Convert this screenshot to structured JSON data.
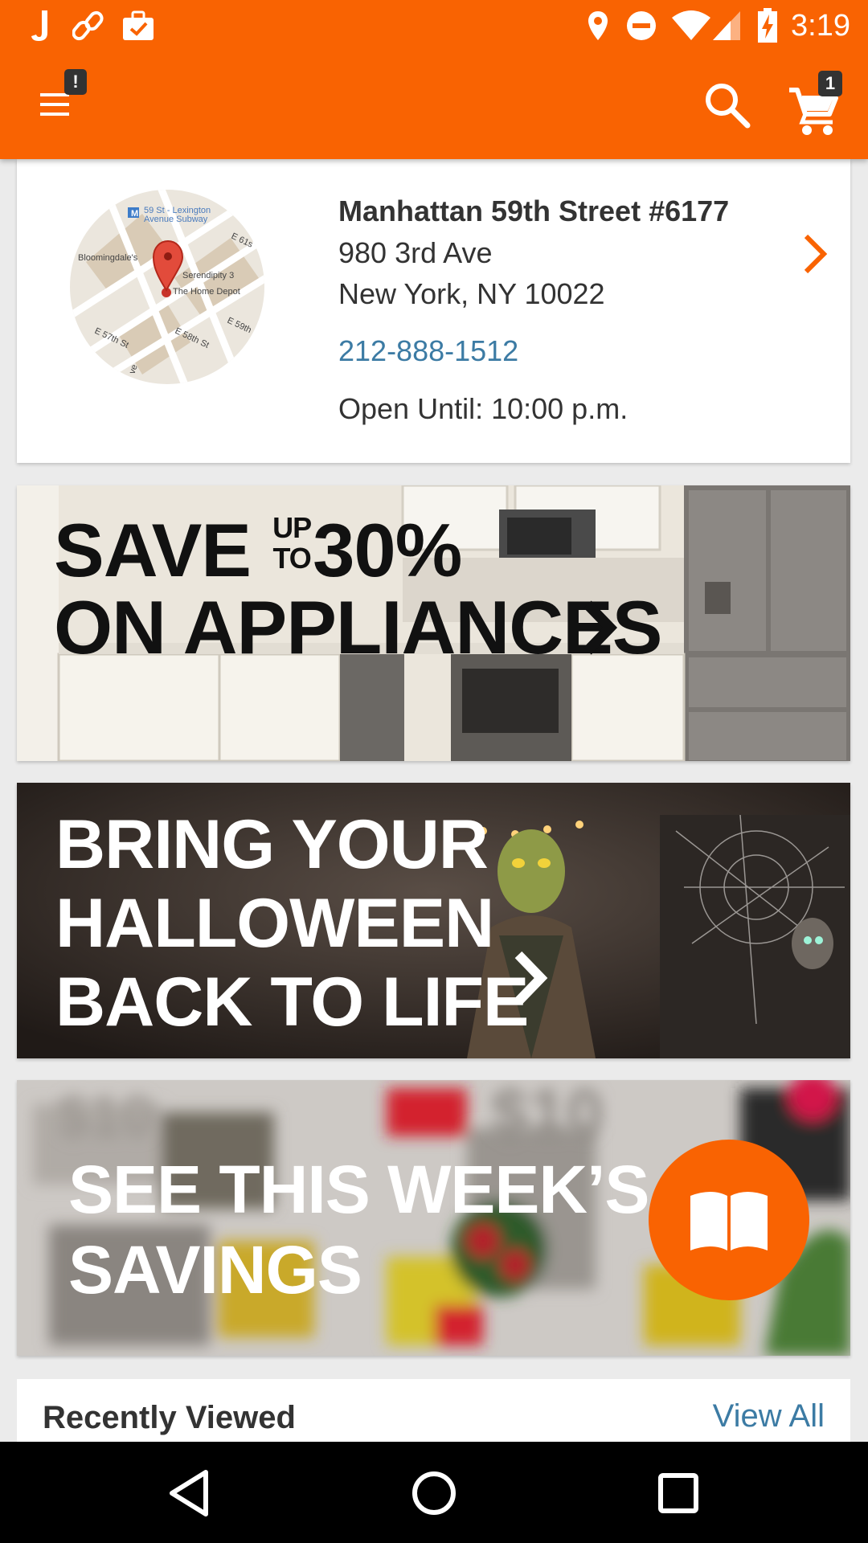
{
  "status_bar": {
    "time": "3:19",
    "left_icons": [
      "j-app-icon",
      "link-icon",
      "briefcase-check-icon"
    ],
    "right_icons": [
      "location-icon",
      "do-not-disturb-icon",
      "wifi-icon",
      "cell-signal-icon",
      "battery-charging-icon"
    ]
  },
  "app_bar": {
    "menu_badge": "!",
    "cart_count": "1"
  },
  "store": {
    "name": "Manhattan 59th Street #6177",
    "address_line1": "980 3rd Ave",
    "address_line2": "New York, NY 10022",
    "phone": "212-888-1512",
    "hours": "Open Until: 10:00 p.m.",
    "map": {
      "subway": "59 St - Lexington",
      "subway2": "Avenue Subway",
      "place1": "Bloomingdale's",
      "place2": "Serendipity 3",
      "place3": "The Home Depot",
      "street1": "E 61s",
      "street2": "E 59th",
      "street3": "E 58th St",
      "street4": "E 57th St",
      "street5": "ve"
    }
  },
  "banners": {
    "appliances": {
      "line1_a": "SAVE",
      "line1_up": "UP",
      "line1_to": "TO",
      "line1_b": "30%",
      "line2": "ON APPLIANCES"
    },
    "halloween": {
      "line1": "BRING YOUR",
      "line2": "HALLOWEEN",
      "line3": "BACK TO LIFE"
    },
    "savings": {
      "line1": "SEE THIS WEEK’S",
      "line2": "SAVINGS",
      "bg_text1": "$10",
      "bg_text2": "$10"
    }
  },
  "recently_viewed": {
    "title": "Recently Viewed",
    "view_all": "View All"
  },
  "colors": {
    "brand_orange": "#f96302",
    "link_blue": "#3c7ba4",
    "text_dark": "#333333"
  }
}
